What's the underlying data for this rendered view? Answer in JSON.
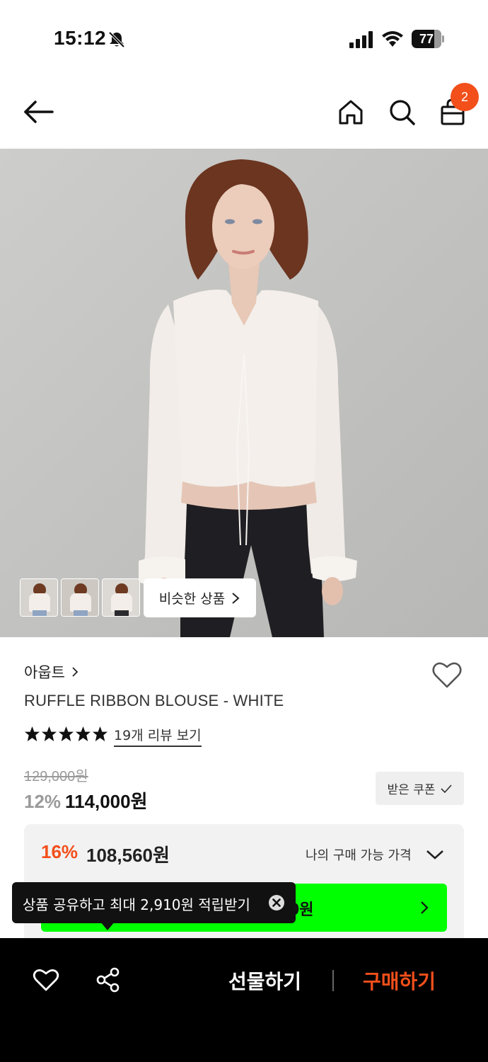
{
  "status_bar": {
    "time": "15:12",
    "battery": "77"
  },
  "header": {
    "cart_count": "2"
  },
  "gallery": {
    "similar_label": "비슷한 상품"
  },
  "product": {
    "brand": "아웁트",
    "name": "RUFFLE RIBBON BLOUSE - WHITE",
    "rating_stars": 5,
    "review_link": "19개 리뷰 보기",
    "original_price": "129,000원",
    "discount_pct": "12%",
    "sale_price": "114,000원",
    "coupon_label": "받은 쿠폰"
  },
  "my_price": {
    "pct": "16%",
    "price": "108,560원",
    "label": "나의 구매 가능 가격",
    "button_text": "0원"
  },
  "toast": {
    "text": "상품 공유하고 최대 2,910원 적립받기"
  },
  "bottom_bar": {
    "gift_label": "선물하기",
    "buy_label": "구매하기"
  },
  "colors": {
    "accent": "#f24f1b",
    "green": "#00ff00",
    "bar": "#000000"
  }
}
